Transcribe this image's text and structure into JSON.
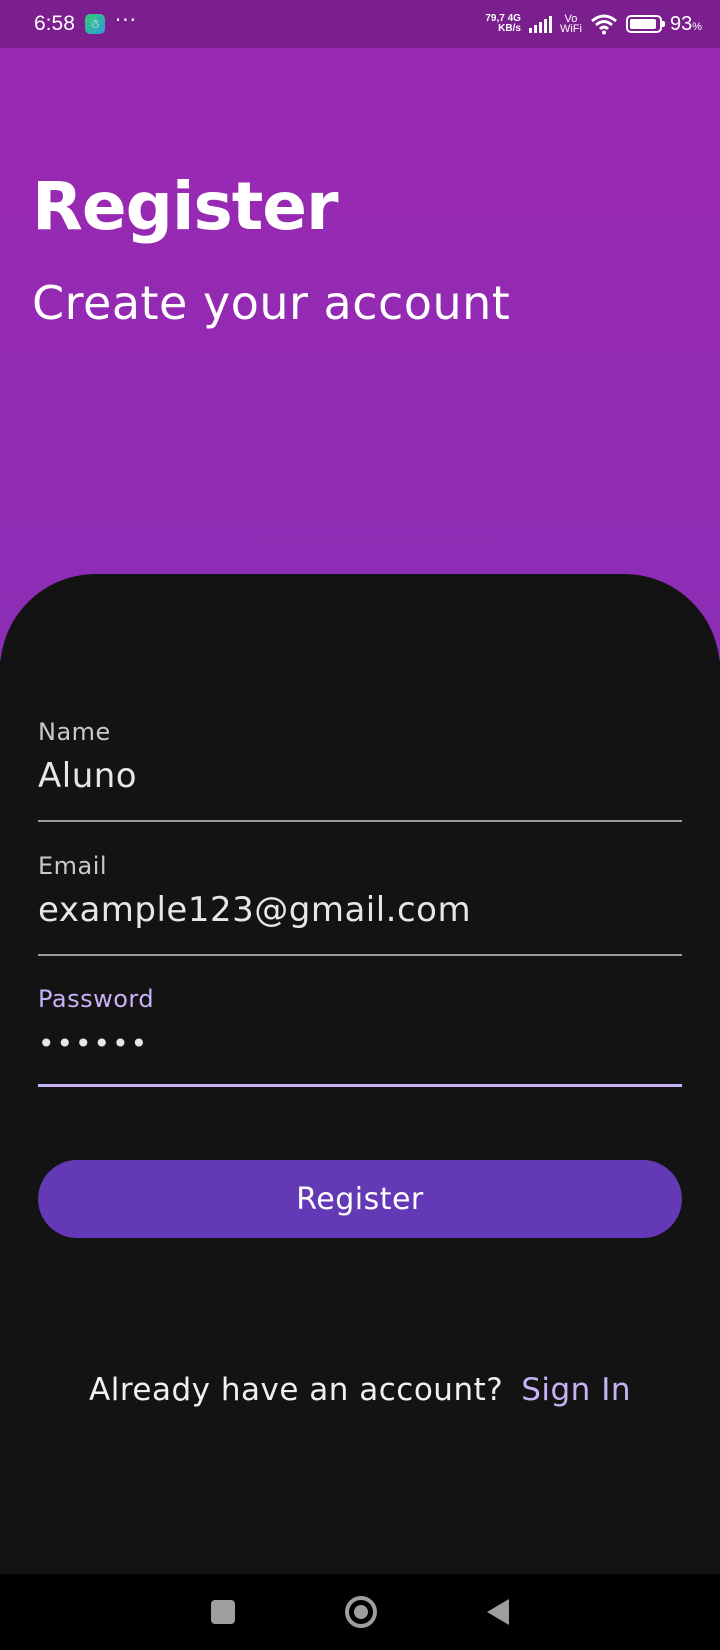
{
  "status_bar": {
    "time": "6:58",
    "more": "···",
    "net_speed_value": "79,7",
    "net_type": "4G",
    "net_speed_unit": "KB/s",
    "vo": "Vo",
    "wifi": "WiFi",
    "battery_percent": "93",
    "battery_unit": "%",
    "battery_level": 0.93
  },
  "header": {
    "title": "Register",
    "subtitle": "Create your account"
  },
  "form": {
    "name": {
      "label": "Name",
      "value": "Aluno"
    },
    "email": {
      "label": "Email",
      "value": "example123@gmail.com"
    },
    "password": {
      "label": "Password",
      "value": "••••••"
    },
    "register_label": "Register"
  },
  "footer": {
    "prompt": "Already have an account?",
    "signin_label": "Sign In"
  },
  "colors": {
    "gradient_top": "#9c27b0",
    "card_bg": "#131313",
    "button": "#6339b6",
    "accent": "#c7b2f5"
  },
  "nav_bar": {
    "icons": [
      "recents-icon",
      "home-icon",
      "back-icon"
    ]
  }
}
